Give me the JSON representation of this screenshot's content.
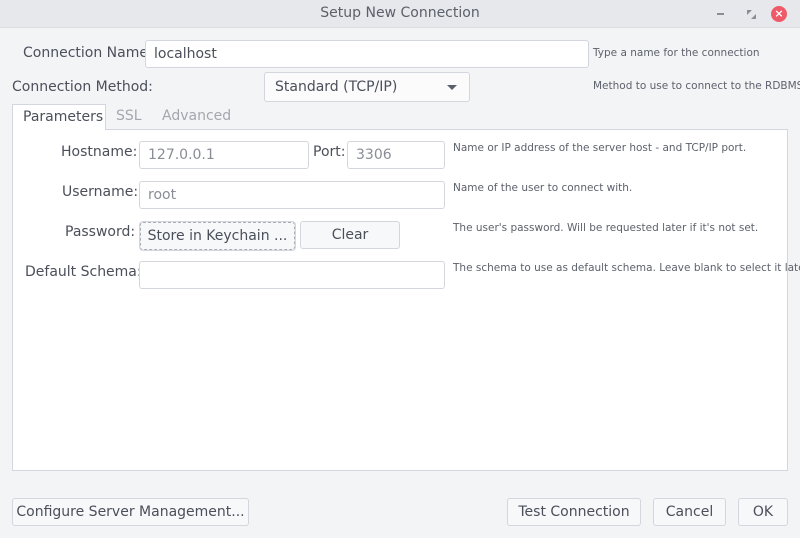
{
  "window": {
    "title": "Setup New Connection",
    "controls": {
      "minimize_icon": "minimize-icon",
      "maximize_icon": "maximize-icon",
      "close_icon": "close-icon",
      "close_glyph": "×"
    }
  },
  "connection_name": {
    "label": "Connection Name:",
    "value": "localhost",
    "hint": "Type a name for the connection"
  },
  "connection_method": {
    "label": "Connection Method:",
    "selected": "Standard (TCP/IP)",
    "hint": "Method to use to connect to the RDBMS"
  },
  "tabs": [
    {
      "label": "Parameters",
      "active": true
    },
    {
      "label": "SSL",
      "active": false
    },
    {
      "label": "Advanced",
      "active": false
    }
  ],
  "parameters": {
    "hostname": {
      "label": "Hostname:",
      "value": "127.0.0.1"
    },
    "port": {
      "label": "Port:",
      "value": "3306"
    },
    "host_hint": "Name or IP address of the server host - and TCP/IP port.",
    "username": {
      "label": "Username:",
      "value": "root",
      "hint": "Name of the user to connect with."
    },
    "password": {
      "label": "Password:",
      "store_button": "Store in Keychain ...",
      "clear_button": "Clear",
      "hint": "The user's password. Will be requested later if it's not set."
    },
    "default_schema": {
      "label": "Default Schema:",
      "value": "",
      "hint": "The schema to use as default schema. Leave blank to select it later."
    }
  },
  "footer": {
    "configure_button": "Configure Server Management...",
    "test_button": "Test Connection",
    "cancel_button": "Cancel",
    "ok_button": "OK"
  }
}
